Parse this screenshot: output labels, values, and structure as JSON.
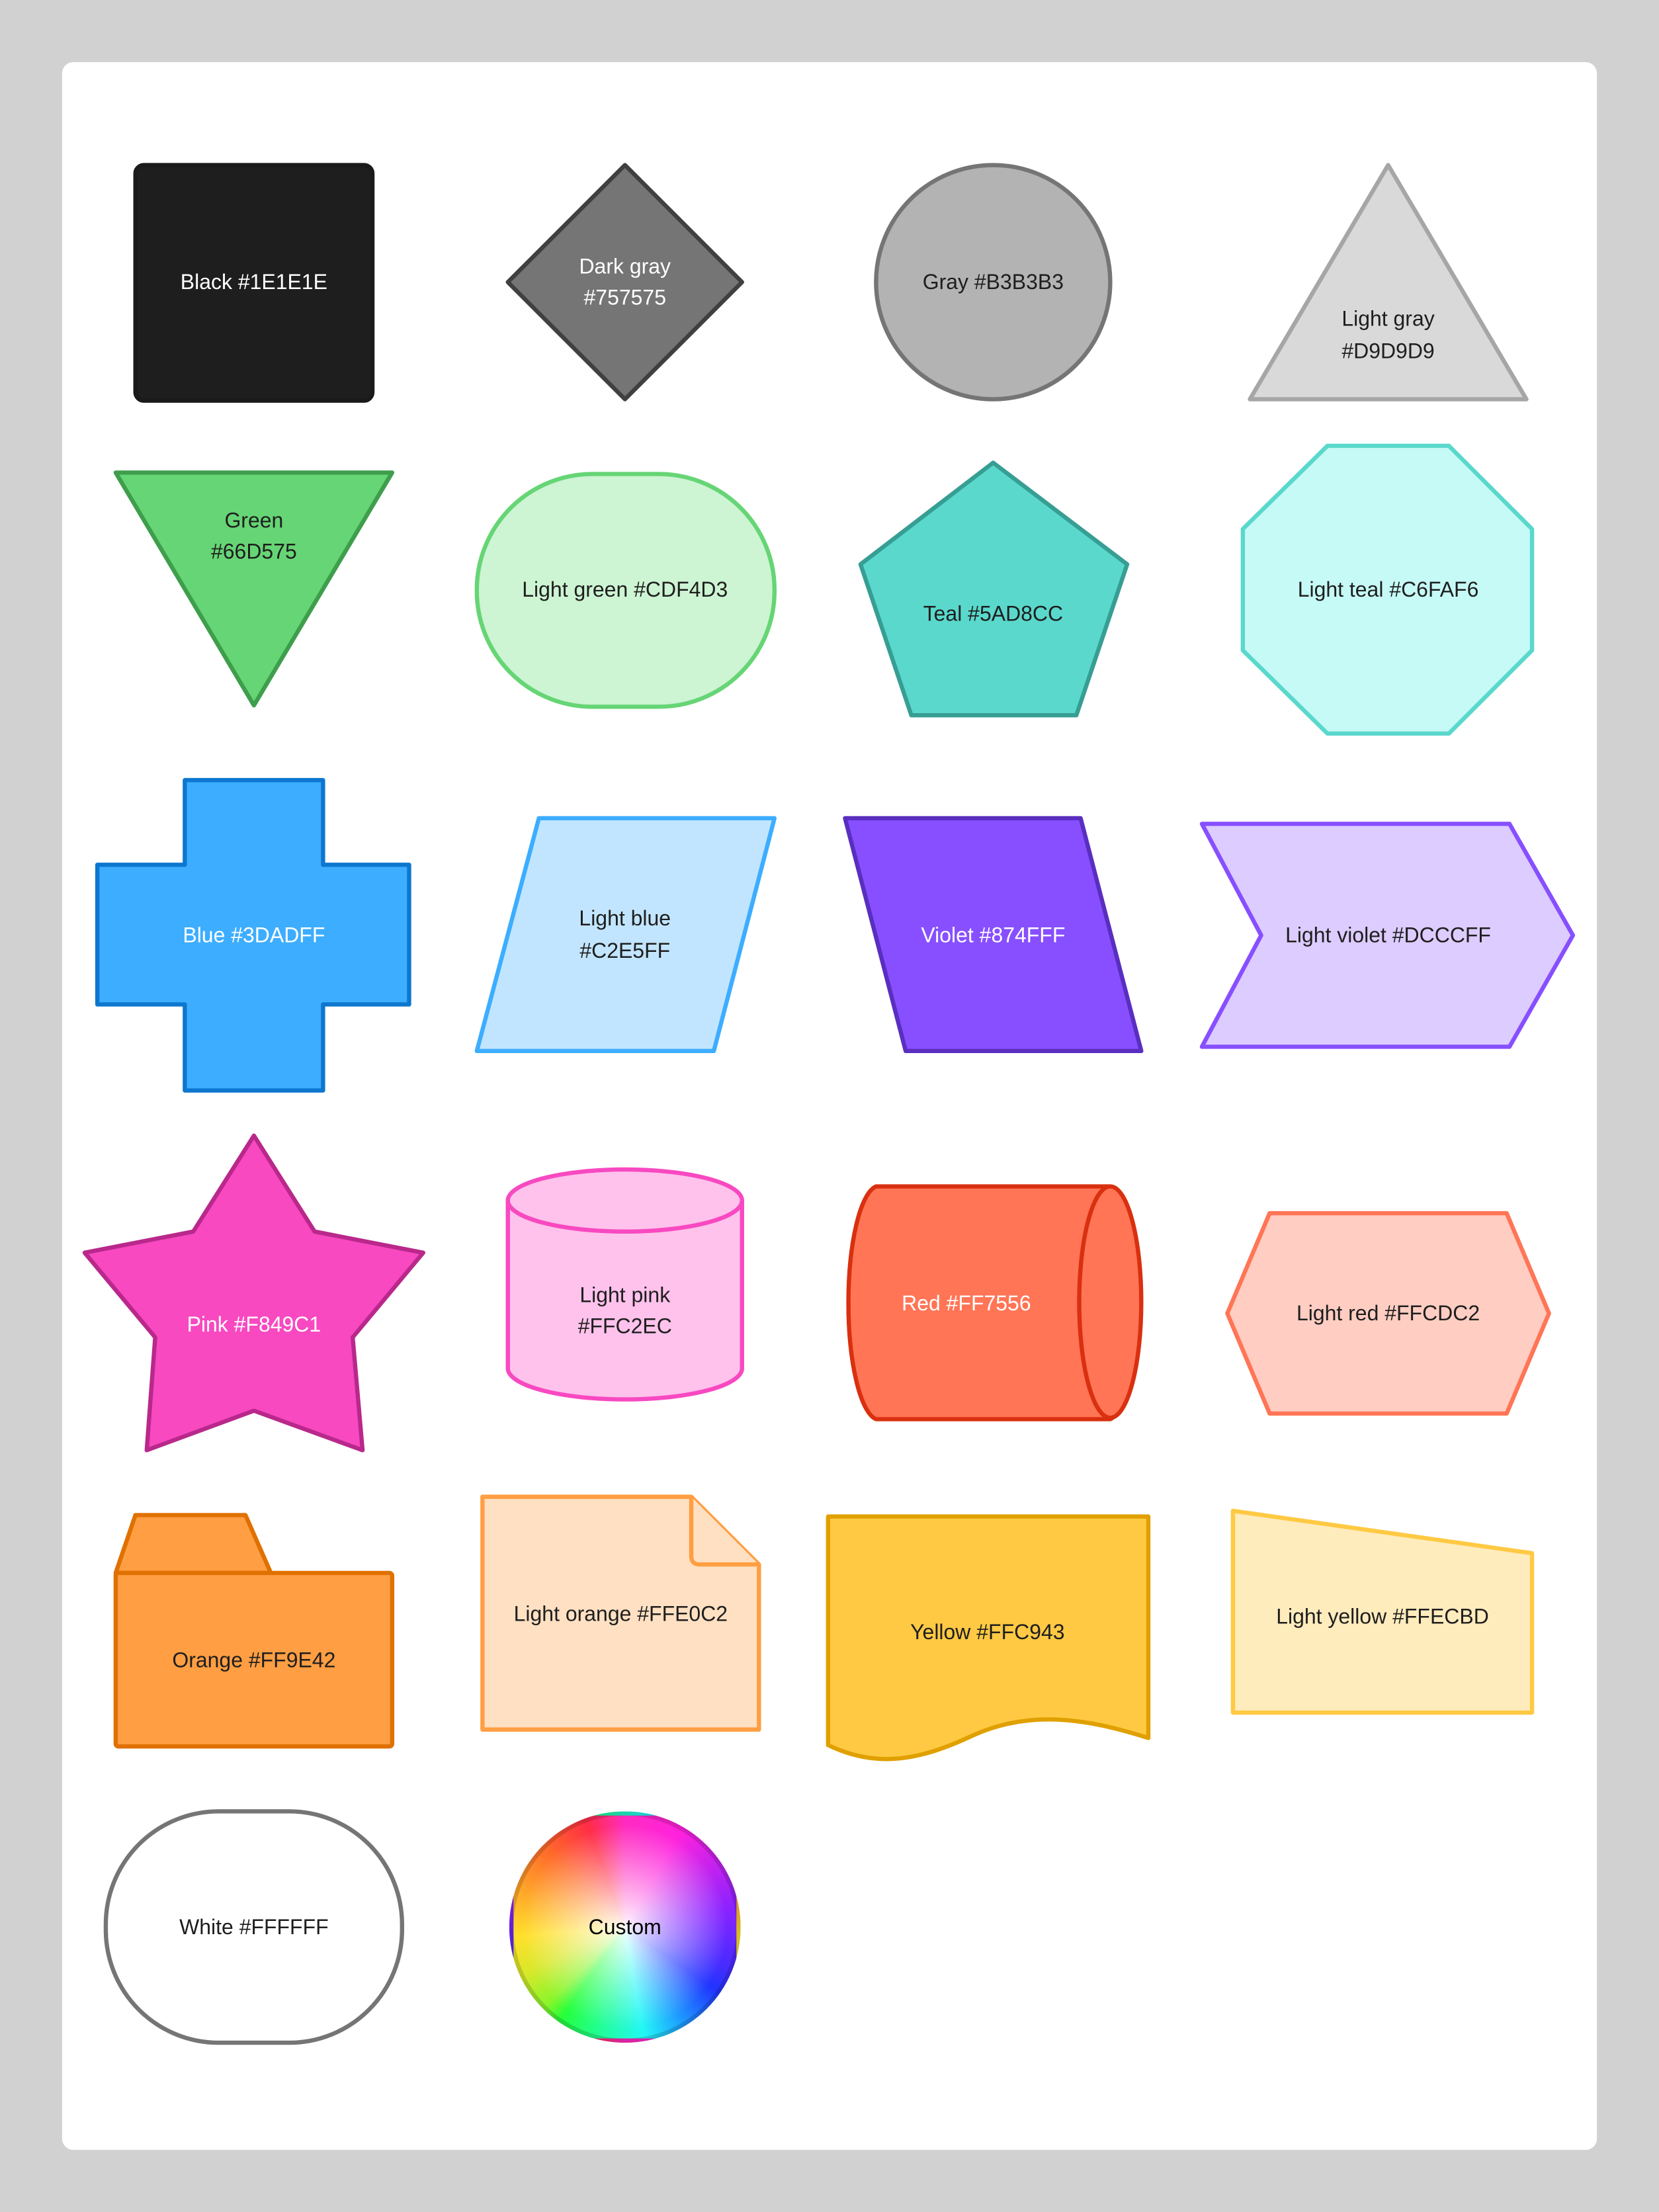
{
  "colors": {
    "background": "#D1D1D1",
    "card": "#FFFFFF"
  },
  "shapes": [
    {
      "shape": "rectangle",
      "lines": [
        "Black #1E1E1E"
      ],
      "fill": "#1E1E1E",
      "stroke": "#1A1A1A",
      "text": "#FFFFFF"
    },
    {
      "shape": "diamond",
      "lines": [
        "Dark gray",
        "#757575"
      ],
      "fill": "#757575",
      "stroke": "#404040",
      "text": "#FFFFFF"
    },
    {
      "shape": "ellipse",
      "lines": [
        "Gray #B3B3B3"
      ],
      "fill": "#B3B3B3",
      "stroke": "#757575",
      "text": "#1E1E1E"
    },
    {
      "shape": "triangle",
      "lines": [
        "Light gray",
        "#D9D9D9"
      ],
      "fill": "#D9D9D9",
      "stroke": "#A6A6A6",
      "text": "#1E1E1E"
    },
    {
      "shape": "triangle-down",
      "lines": [
        "Green",
        "#66D575"
      ],
      "fill": "#66D575",
      "stroke": "#3E9E4C",
      "text": "#1E1E1E"
    },
    {
      "shape": "rounded-rectangle",
      "lines": [
        "Light green #CDF4D3"
      ],
      "fill": "#CDF4D3",
      "stroke": "#66D575",
      "text": "#1E1E1E"
    },
    {
      "shape": "pentagon",
      "lines": [
        "Teal #5AD8CC"
      ],
      "fill": "#5AD8CC",
      "stroke": "#379E94",
      "text": "#1E1E1E"
    },
    {
      "shape": "octagon",
      "lines": [
        "Light teal #C6FAF6"
      ],
      "fill": "#C6FAF6",
      "stroke": "#5AD8CC",
      "text": "#1E1E1E"
    },
    {
      "shape": "cross",
      "lines": [
        "Blue #3DADFF"
      ],
      "fill": "#3DADFF",
      "stroke": "#0D77CF",
      "text": "#FFFFFF"
    },
    {
      "shape": "parallelogram",
      "lines": [
        "Light blue",
        "#C2E5FF"
      ],
      "fill": "#C2E5FF",
      "stroke": "#3DADFF",
      "text": "#1E1E1E"
    },
    {
      "shape": "parallelogram-reverse",
      "lines": [
        "Violet #874FFF"
      ],
      "fill": "#874FFF",
      "stroke": "#5A2EC0",
      "text": "#FFFFFF"
    },
    {
      "shape": "chevron",
      "lines": [
        "Light violet #DCCCFF"
      ],
      "fill": "#DCCCFF",
      "stroke": "#874FFF",
      "text": "#1E1E1E"
    },
    {
      "shape": "star",
      "lines": [
        "Pink #F849C1"
      ],
      "fill": "#F849C1",
      "stroke": "#B9288B",
      "text": "#FFFFFF"
    },
    {
      "shape": "cylinder",
      "lines": [
        "Light pink",
        "#FFC2EC"
      ],
      "fill": "#FFC2EC",
      "stroke": "#F849C1",
      "text": "#1E1E1E"
    },
    {
      "shape": "horizontal-cylinder",
      "lines": [
        "Red #FF7556"
      ],
      "fill": "#FF7556",
      "stroke": "#D9300F",
      "text": "#FFFFFF"
    },
    {
      "shape": "hexagon",
      "lines": [
        "Light red #FFCDC2"
      ],
      "fill": "#FFCDC2",
      "stroke": "#FF7556",
      "text": "#1E1E1E"
    },
    {
      "shape": "folder",
      "lines": [
        "Orange #FF9E42"
      ],
      "fill": "#FF9E42",
      "stroke": "#E07000",
      "text": "#1E1E1E"
    },
    {
      "shape": "document",
      "lines": [
        "Light orange #FFE0C2"
      ],
      "fill": "#FFE0C2",
      "stroke": "#FF9E42",
      "text": "#1E1E1E"
    },
    {
      "shape": "wavy-document",
      "lines": [
        "Yellow #FFC943"
      ],
      "fill": "#FFC943",
      "stroke": "#E0A000",
      "text": "#1E1E1E"
    },
    {
      "shape": "manual-input",
      "lines": [
        "Light yellow #FFECBD"
      ],
      "fill": "#FFECBD",
      "stroke": "#FFC943",
      "text": "#1E1E1E"
    },
    {
      "shape": "rounded-rectangle",
      "lines": [
        "White #FFFFFF"
      ],
      "fill": "#FFFFFF",
      "stroke": "#757575",
      "text": "#1E1E1E"
    },
    {
      "shape": "color-wheel",
      "lines": [
        "Custom"
      ],
      "text": "#000000"
    }
  ]
}
